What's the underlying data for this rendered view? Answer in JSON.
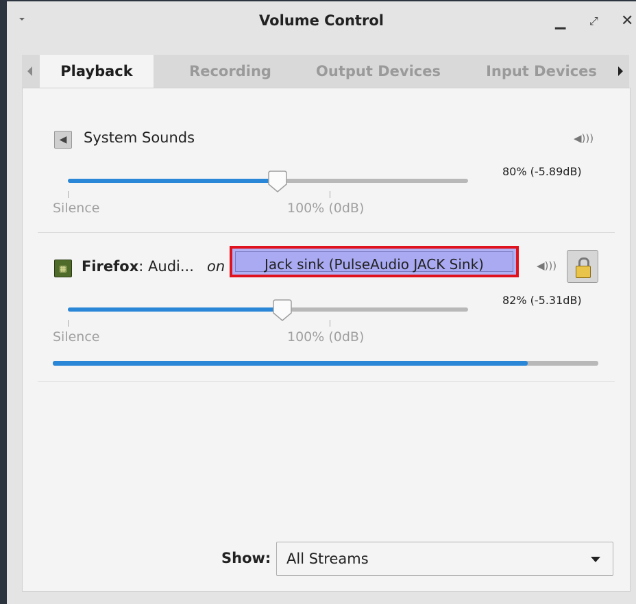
{
  "window": {
    "title": "Volume Control"
  },
  "tabs": [
    {
      "label": "Playback",
      "active": true
    },
    {
      "label": "Recording",
      "active": false
    },
    {
      "label": "Output Devices",
      "active": false
    },
    {
      "label": "Input Devices",
      "active": false
    }
  ],
  "streams": [
    {
      "name": "System Sounds",
      "icon": "speaker-icon",
      "volume_percent": 80,
      "volume_label": "80% (-5.89dB)",
      "marks": {
        "silence": "Silence",
        "full": "100% (0dB)"
      }
    },
    {
      "app_name": "Firefox",
      "media_title": ": Audi...",
      "connector": "on",
      "icon": "audio-card-icon",
      "device": "Jack sink (PulseAudio JACK Sink)",
      "volume_percent": 82,
      "volume_label": "82% (-5.31dB)",
      "marks": {
        "silence": "Silence",
        "full": "100% (0dB)"
      },
      "peak_level_percent": 87,
      "locked": true
    }
  ],
  "filter": {
    "label": "Show:",
    "value": "All Streams"
  },
  "colors": {
    "accent": "#2a86d6",
    "device_button": "#aaaaf2",
    "highlight_border": "#e0121e"
  }
}
